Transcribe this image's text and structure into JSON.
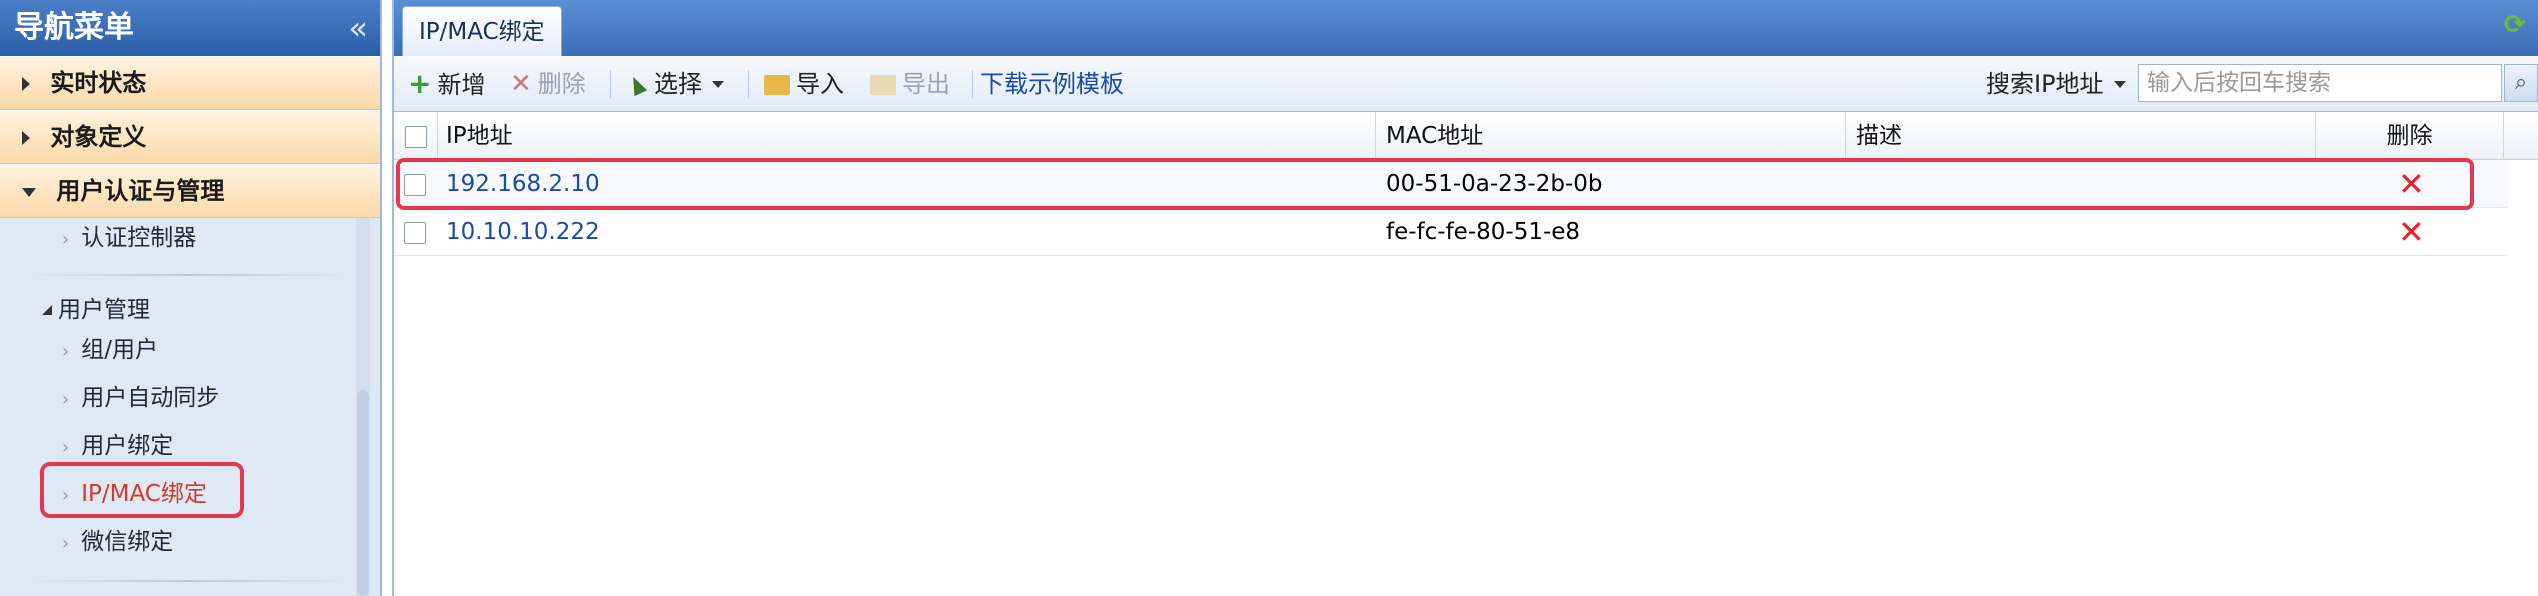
{
  "nav": {
    "title": "导航菜单",
    "collapse_glyph": "«",
    "sections": [
      {
        "label": "实时状态"
      },
      {
        "label": "对象定义"
      },
      {
        "label": "用户认证与管理"
      }
    ],
    "items": {
      "auth_controller": "认证控制器",
      "group_label": "用户管理",
      "group_user": "组/用户",
      "user_sync": "用户自动同步",
      "user_binding": "用户绑定",
      "ipmac_binding": "IP/MAC绑定",
      "wechat_binding": "微信绑定"
    }
  },
  "tab": {
    "label": "IP/MAC绑定"
  },
  "toolbar": {
    "add": "新增",
    "delete": "删除",
    "select": "选择",
    "import": "导入",
    "export": "导出",
    "download_template": "下载示例模板",
    "search_label": "搜索IP地址",
    "search_placeholder": "输入后按回车搜索"
  },
  "grid": {
    "headers": {
      "ip": "IP地址",
      "mac": "MAC地址",
      "desc": "描述",
      "del": "删除"
    },
    "rows": [
      {
        "ip": "192.168.2.10",
        "mac": "00-51-0a-23-2b-0b",
        "desc": "",
        "del": "✕"
      },
      {
        "ip": "10.10.10.222",
        "mac": "fe-fc-fe-80-51-e8",
        "desc": "",
        "del": "✕"
      }
    ]
  },
  "colors": {
    "accent_blue": "#3a6db6",
    "highlight_red": "#e13a4f",
    "delete_red": "#e0262d"
  }
}
